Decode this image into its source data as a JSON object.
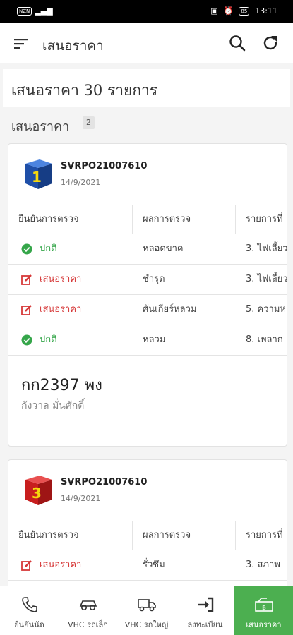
{
  "statusbar": {
    "left_badge": "NZN",
    "time": "13:11",
    "battery": "85"
  },
  "appbar": {
    "title": "เสนอราคา"
  },
  "header": {
    "title": "เสนอราคา 30 รายการ"
  },
  "section": {
    "title": "เสนอราคา",
    "count": "2"
  },
  "table_headers": [
    "ยืนยันการตรวจ",
    "ผลการตรวจ",
    "รายการที่"
  ],
  "cards": [
    {
      "doc_no": "SVRPO21007610",
      "date": "14/9/2021",
      "cube_number": "1",
      "rows": [
        {
          "status": "ปกติ",
          "status_type": "ok",
          "result": "หลอดขาด",
          "item": "3. ไฟเลี้ยว"
        },
        {
          "status": "เสนอราคา",
          "status_type": "quote",
          "result": "ชำรุด",
          "item": "3. ไฟเลี้ยว"
        },
        {
          "status": "เสนอราคา",
          "status_type": "quote",
          "result": "ศันเกียร์หลวม",
          "item": "5. ความห"
        },
        {
          "status": "ปกติ",
          "status_type": "ok",
          "result": "หลวม",
          "item": "8. เพลาก"
        }
      ],
      "plate": "กก2397 พง",
      "owner": "กังวาล มั่นศักดิ์"
    },
    {
      "doc_no": "SVRPO21007610",
      "date": "14/9/2021",
      "cube_number": "3",
      "rows": [
        {
          "status": "เสนอราคา",
          "status_type": "quote",
          "result": "รั่วซึม",
          "item": "3. สภาพ"
        }
      ]
    }
  ],
  "bottom_nav": [
    {
      "label": "ยืนยันนัด",
      "icon": "phone-icon"
    },
    {
      "label": "VHC รถเล็ก",
      "icon": "car-icon"
    },
    {
      "label": "VHC รถใหญ่",
      "icon": "truck-icon"
    },
    {
      "label": "ลงทะเบียน",
      "icon": "login-icon"
    },
    {
      "label": "เสนอราคา",
      "icon": "quote-icon"
    }
  ],
  "colors": {
    "ok": "#35a64a",
    "quote": "#d63838",
    "active_tab": "#4caf50",
    "cube_blue": "#1f4fa8",
    "cube_red": "#c81e1e",
    "cube_number": "#f5d80d"
  }
}
